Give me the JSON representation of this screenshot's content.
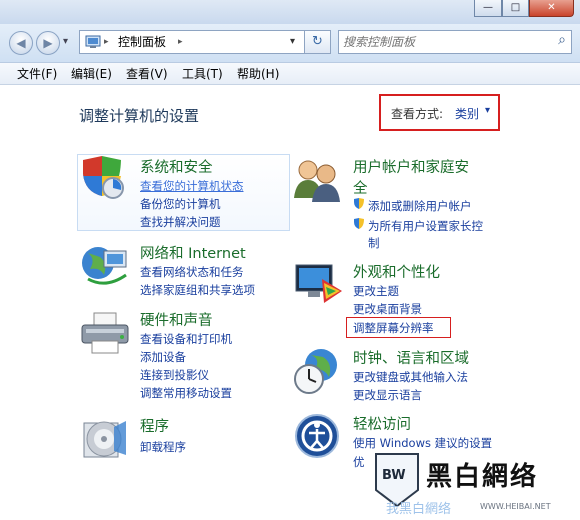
{
  "window": {
    "minimize": "—",
    "maximize": "□",
    "close": "✕"
  },
  "address": {
    "back": "◀",
    "forward": "▶",
    "history": "▾",
    "crumb_sep": "▸",
    "path": "控制面板",
    "path_sep": "▸",
    "dropdown": "▾",
    "refresh": "↻",
    "search_placeholder": "搜索控制面板",
    "search_icon": "⌕"
  },
  "menu": [
    "文件(F)",
    "编辑(E)",
    "查看(V)",
    "工具(T)",
    "帮助(H)"
  ],
  "page": {
    "heading": "调整计算机的设置",
    "view_label": "查看方式:",
    "view_value": "类别",
    "view_arrow": "▾"
  },
  "categories": [
    {
      "title": "系统和安全",
      "icon": "shield-icon",
      "links": [
        "查看您的计算机状态",
        "备份您的计算机",
        "查找并解决问题"
      ]
    },
    {
      "title": "网络和 Internet",
      "icon": "network-globe-icon",
      "links": [
        "查看网络状态和任务",
        "选择家庭组和共享选项"
      ]
    },
    {
      "title": "硬件和声音",
      "icon": "printer-icon",
      "links": [
        "查看设备和打印机",
        "添加设备",
        "连接到投影仪",
        "调整常用移动设置"
      ]
    },
    {
      "title": "程序",
      "icon": "programs-disc-icon",
      "links": [
        "卸载程序"
      ]
    },
    {
      "title_line1": "用户帐户和家庭安",
      "title_line2": "全",
      "icon": "users-icon",
      "links": [
        "添加或删除用户帐户",
        "为所有用户设置家长控",
        "制"
      ]
    },
    {
      "title": "外观和个性化",
      "icon": "monitor-palette-icon",
      "links": [
        "更改主题",
        "更改桌面背景",
        "调整屏幕分辨率"
      ]
    },
    {
      "title": "时钟、语言和区域",
      "icon": "clock-globe-icon",
      "links": [
        "更改键盘或其他输入法",
        "更改显示语言"
      ]
    },
    {
      "title": "轻松访问",
      "icon": "ease-of-access-icon",
      "links": [
        "使用 Windows 建议的设置",
        "优"
      ]
    }
  ],
  "watermark": {
    "logo": "BW",
    "text": "黑白網络",
    "sub": "我黑白網络",
    "url": "WWW.HEIBAI.NET"
  },
  "colors": {
    "link": "#1a3f9e",
    "category_title": "#1a6c2b",
    "highlight_box": "#d61f1f"
  }
}
